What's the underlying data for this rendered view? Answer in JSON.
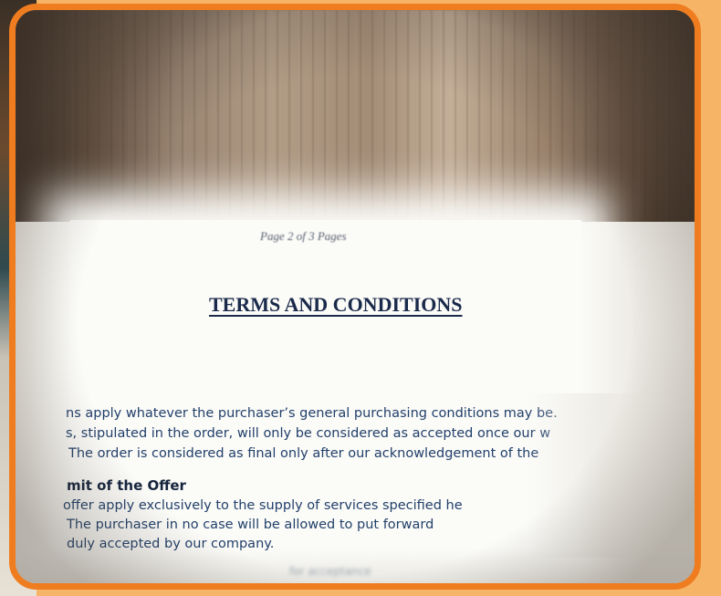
{
  "document": {
    "page_number": "Page 2 of 3 Pages",
    "title": "TERMS AND CONDITIONS",
    "paragraph_lines": [
      "ns apply whatever the purchaser’s general purchasing conditions may be.",
      "s, stipulated in the order, will only be considered as accepted once our w",
      "The order is considered as final only after our acknowledgement of the"
    ],
    "section_heading": "mit of the Offer",
    "section_lines": [
      "offer apply exclusively to the supply of services specified he",
      "The purchaser in no case will be allowed to put forward",
      "duly accepted by our company."
    ],
    "blurred_bottom_text": "for acceptance"
  },
  "colors": {
    "frame": "#ef7d1f",
    "background": "#f6b466",
    "ink": "#22406a"
  }
}
